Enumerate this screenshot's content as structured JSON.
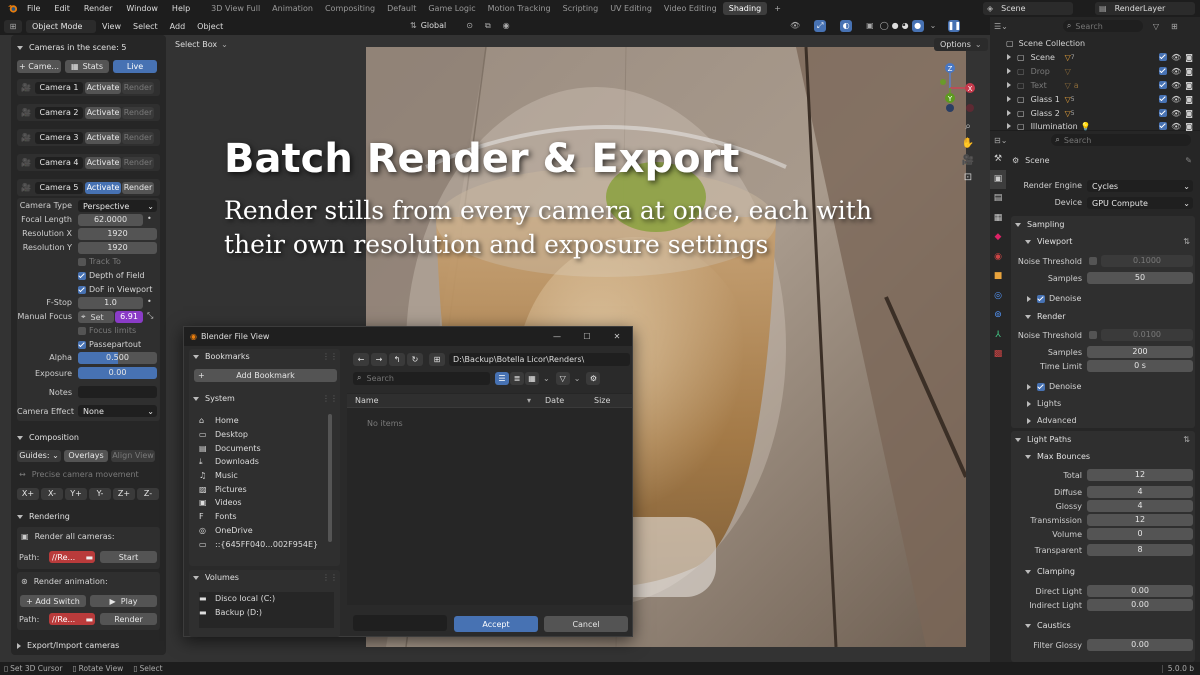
{
  "menu": [
    "File",
    "Edit",
    "Render",
    "Window",
    "Help"
  ],
  "workspaces": [
    "3D View Full",
    "Animation",
    "Compositing",
    "Default",
    "Game Logic",
    "Motion Tracking",
    "Scripting",
    "UV Editing",
    "Video Editing",
    "Shading"
  ],
  "active_workspace": "Shading",
  "scene_name": "Scene",
  "view_layer": "RenderLayer",
  "viewport_header": {
    "mode": "Object Mode",
    "menus": [
      "View",
      "Select",
      "Add",
      "Object"
    ],
    "transform": "Global",
    "select_box": "Select Box",
    "options": "Options"
  },
  "overlay_text": {
    "title": "Batch Render & Export",
    "subtitle_line1": "Render stills from every camera at once, each with",
    "subtitle_line2": "their own resolution and exposure settings"
  },
  "cameras_panel": {
    "header": "Cameras in the scene: 5",
    "add_btn": "Came...",
    "stats_btn": "Stats",
    "live_btn": "Live",
    "cameras": [
      {
        "name": "Camera 1",
        "activate": "Activate",
        "render": "Render",
        "active": false
      },
      {
        "name": "Camera 2",
        "activate": "Activate",
        "render": "Render",
        "active": false
      },
      {
        "name": "Camera 3",
        "activate": "Activate",
        "render": "Render",
        "active": false
      },
      {
        "name": "Camera 4",
        "activate": "Activate",
        "render": "Render",
        "active": false
      },
      {
        "name": "Camera 5",
        "activate": "Activate",
        "render": "Render",
        "active": true
      }
    ]
  },
  "camera_props": {
    "type_label": "Camera Type",
    "type_value": "Perspective",
    "focal_label": "Focal Length",
    "focal_value": "62.0000",
    "resx_label": "Resolution X",
    "resx_value": "1920",
    "resy_label": "Resolution Y",
    "resy_value": "1920",
    "track_to": "Track To",
    "dof": "Depth of Field",
    "dof_viewport": "DoF in Viewport",
    "fstop_label": "F-Stop",
    "fstop_value": "1.0",
    "manual_focus_label": "Manual Focus",
    "set_label": "Set",
    "focus_value": "6.91",
    "focus_limits": "Focus limits",
    "passepartout": "Passepartout",
    "alpha_label": "Alpha",
    "alpha_value": "0.500",
    "alpha_fill": 0.5,
    "exposure_label": "Exposure",
    "exposure_value": "0.00",
    "notes_label": "Notes",
    "effect_label": "Camera Effect",
    "effect_value": "None"
  },
  "composition": {
    "header": "Composition",
    "guides": "Guides:",
    "overlays": "Overlays",
    "align_view": "Align View",
    "precise": "Precise camera movement",
    "axes": [
      "X+",
      "X-",
      "Y+",
      "Y-",
      "Z+",
      "Z-"
    ]
  },
  "rendering": {
    "header": "Rendering",
    "render_all": "Render all cameras:",
    "path_label": "Path:",
    "path_value": "//Re...",
    "start": "Start",
    "render_anim": "Render animation:",
    "add_switch": "Add Switch",
    "play": "Play",
    "render": "Render"
  },
  "export_header": "Export/Import cameras",
  "file_dialog": {
    "title": "Blender File View",
    "bookmarks": "Bookmarks",
    "add_bookmark": "Add Bookmark",
    "system": "System",
    "system_items": [
      "Home",
      "Desktop",
      "Documents",
      "Downloads",
      "Music",
      "Pictures",
      "Videos",
      "Fonts",
      "OneDrive",
      "::{645FF040...002F954E}"
    ],
    "volumes": "Volumes",
    "volume_items": [
      "Disco local (C:)",
      "Backup (D:)"
    ],
    "path": "D:\\Backup\\Botella Licor\\Renders\\",
    "search_placeholder": "Search",
    "columns": {
      "name": "Name",
      "date": "Date",
      "size": "Size"
    },
    "empty": "No items",
    "accept": "Accept",
    "cancel": "Cancel"
  },
  "outliner": {
    "search_placeholder": "Search",
    "collection": "Scene Collection",
    "items": [
      "Scene",
      "Drop",
      "Text",
      "Glass 1",
      "Glass 2",
      "Illumination"
    ],
    "sub_counts": [
      "7",
      "",
      "",
      "5",
      "5",
      ""
    ]
  },
  "properties": {
    "search_placeholder": "Search",
    "scene": "Scene",
    "render_engine_label": "Render Engine",
    "render_engine": "Cycles",
    "device_label": "Device",
    "device": "GPU Compute",
    "sampling": "Sampling",
    "viewport": "Viewport",
    "noise_threshold": "Noise Threshold",
    "vp_noise": "0.1000",
    "samples": "Samples",
    "vp_samples": "50",
    "denoise": "Denoise",
    "render": "Render",
    "r_noise": "0.0100",
    "r_samples": "200",
    "time_limit": "Time Limit",
    "time_value": "0 s",
    "lights": "Lights",
    "advanced": "Advanced",
    "light_paths": "Light Paths",
    "max_bounces": "Max Bounces",
    "bounces": [
      {
        "label": "Total",
        "value": "12"
      },
      {
        "label": "Diffuse",
        "value": "4"
      },
      {
        "label": "Glossy",
        "value": "4"
      },
      {
        "label": "Transmission",
        "value": "12"
      },
      {
        "label": "Volume",
        "value": "0"
      },
      {
        "label": "Transparent",
        "value": "8"
      }
    ],
    "clamping": "Clamping",
    "direct_light": "Direct Light",
    "direct_value": "0.00",
    "indirect_light": "Indirect Light",
    "indirect_value": "0.00",
    "caustics": "Caustics",
    "filter_glossy": "Filter Glossy",
    "filter_value": "0.00"
  },
  "status_bar": {
    "cursor": "Set 3D Cursor",
    "rotate": "Rotate View",
    "select": "Select",
    "version": "5.0.0 b"
  }
}
